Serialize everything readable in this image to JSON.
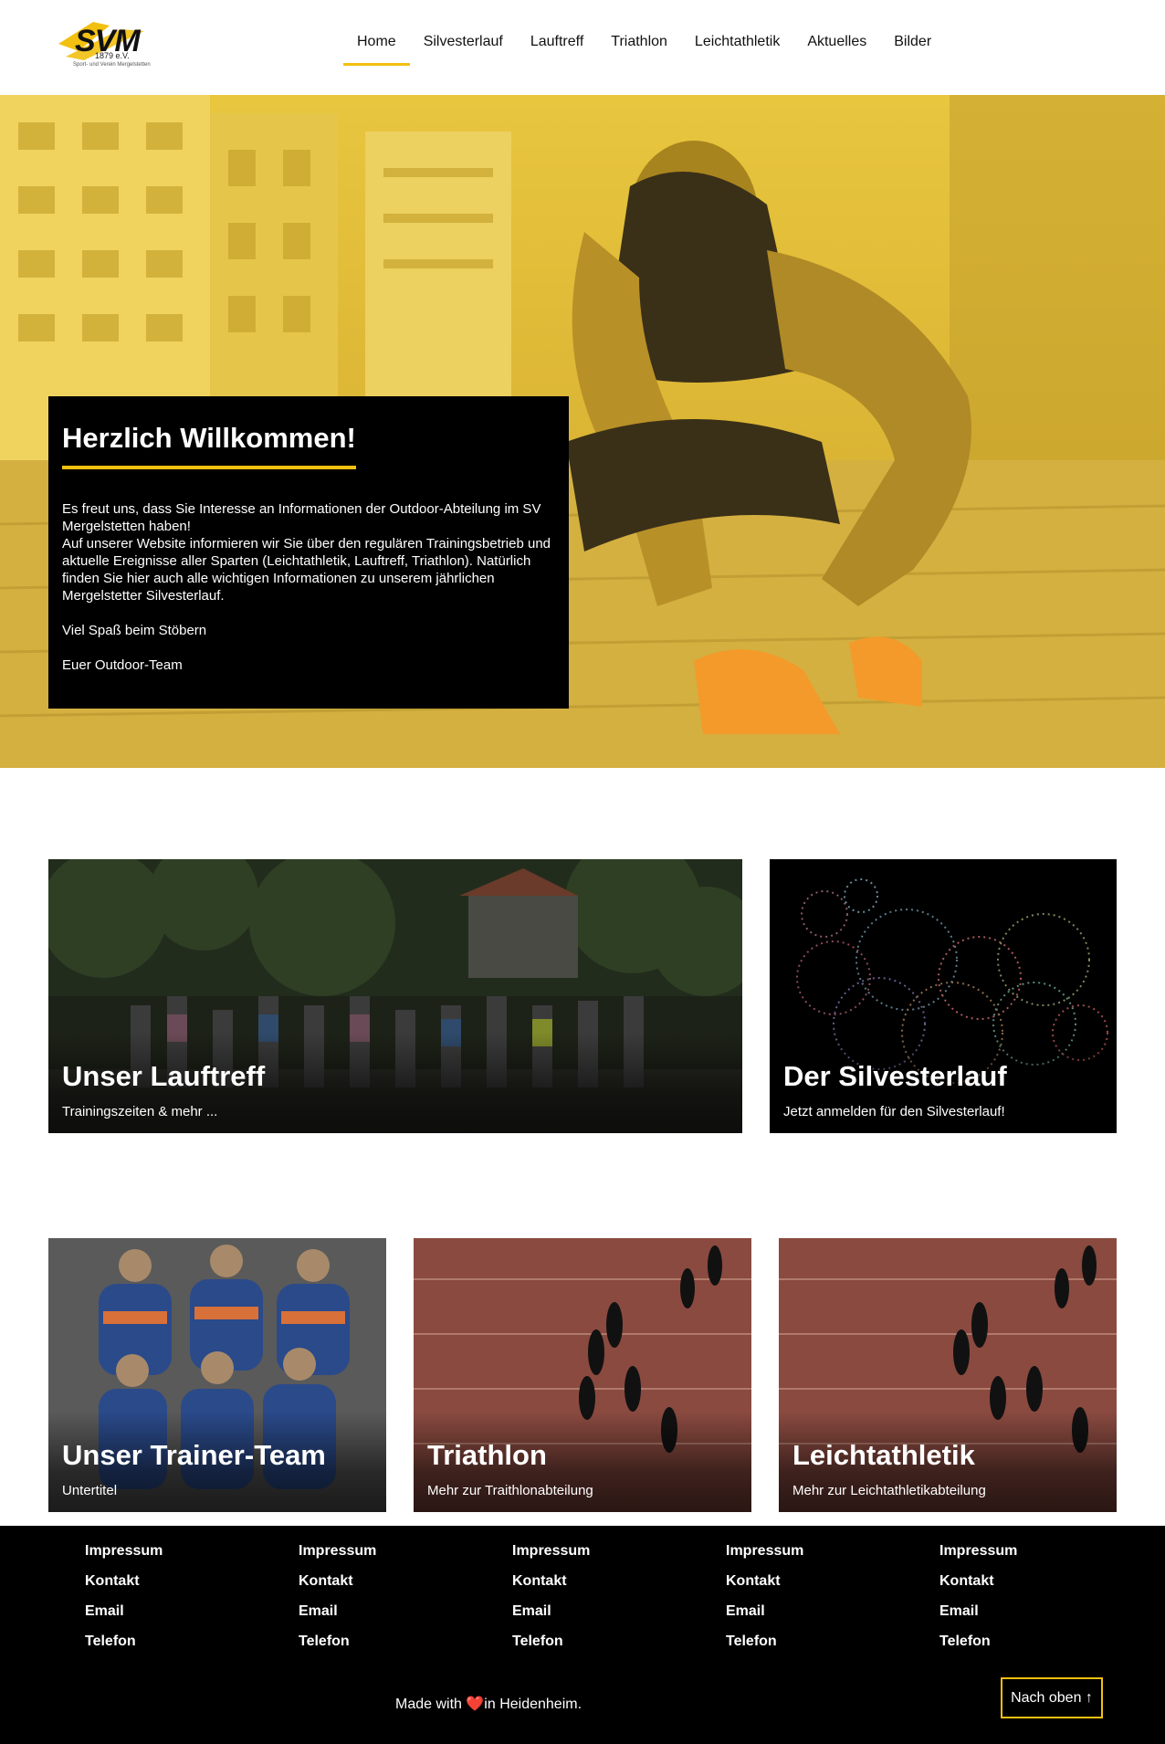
{
  "header": {
    "logo": {
      "name": "SVM",
      "year": "1879 e.V.",
      "tagline": "Sport- und Verein Mergelstetten"
    },
    "nav": [
      {
        "label": "Home",
        "active": true
      },
      {
        "label": "Silvesterlauf"
      },
      {
        "label": "Lauftreff"
      },
      {
        "label": "Triathlon"
      },
      {
        "label": "Leichtathletik"
      },
      {
        "label": "Aktuelles"
      },
      {
        "label": "Bilder"
      }
    ]
  },
  "hero": {
    "title": "Herzlich Willkommen!",
    "paragraphs": [
      "Es freut uns, dass Sie Interesse an Informationen der Outdoor-Abteilung im SV Mergelstetten haben!\nAuf unserer Website informieren wir Sie über den regulären Trainingsbetrieb und aktuelle Ereignisse aller Sparten (Leichtathletik, Lauftreff, Triathlon). Natürlich finden Sie hier auch alle wichtigen Informationen zu unserem jährlichen Mergelstetter Silvesterlauf.",
      "Viel Spaß beim Stöbern",
      "Euer Outdoor-Team"
    ]
  },
  "cards": {
    "lauftreff": {
      "title": "Unser Lauftreff",
      "subtitle": "Trainingszeiten & mehr ..."
    },
    "silvesterlauf": {
      "title": "Der Silvesterlauf",
      "subtitle": "Jetzt anmelden für den Silvesterlauf!"
    },
    "trainer": {
      "title": "Unser Trainer-Team",
      "subtitle": "Untertitel"
    },
    "triathlon": {
      "title": "Triathlon",
      "subtitle": "Mehr zur Traithlonabteilung"
    },
    "leichtathletik": {
      "title": "Leichtathletik",
      "subtitle": "Mehr zur Leichtathletikabteilung"
    }
  },
  "footer": {
    "columns": [
      [
        "Impressum",
        "Kontakt",
        "Email",
        "Telefon"
      ],
      [
        "Impressum",
        "Kontakt",
        "Email",
        "Telefon"
      ],
      [
        "Impressum",
        "Kontakt",
        "Email",
        "Telefon"
      ],
      [
        "Impressum",
        "Kontakt",
        "Email",
        "Telefon"
      ],
      [
        "Impressum",
        "Kontakt",
        "Email",
        "Telefon"
      ]
    ],
    "made_prefix": "Made with ",
    "made_heart": "❤️",
    "made_suffix": "in Heidenheim.",
    "back_to_top": "Nach oben ↑"
  },
  "colors": {
    "accent": "#f2c010",
    "hero_tint": "#e0bd3a",
    "footer_bg": "#000000",
    "heart": "#e0282e"
  },
  "icons": {
    "heart": "heart-icon",
    "arrow": "arrow-up-icon"
  }
}
